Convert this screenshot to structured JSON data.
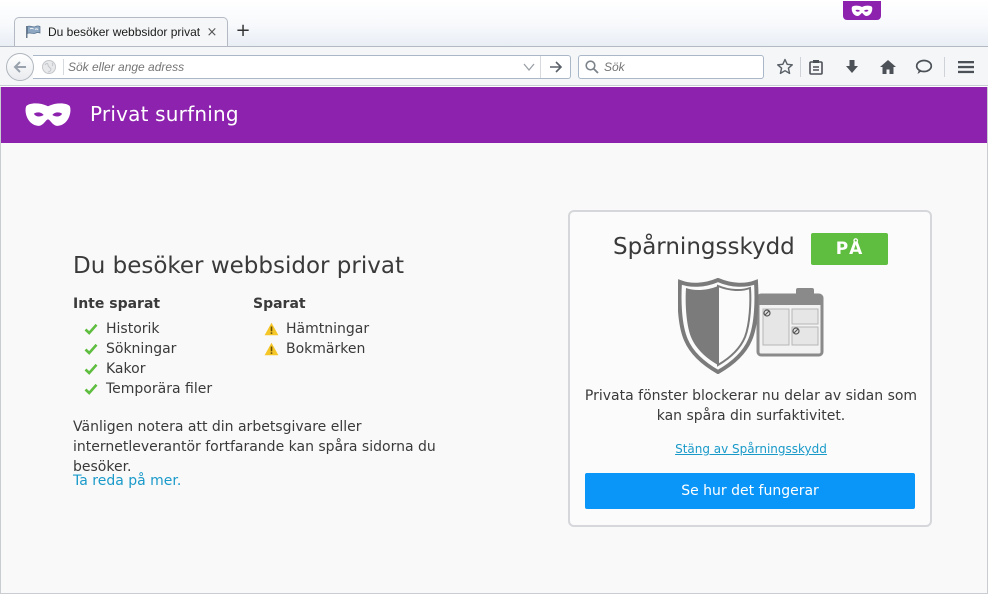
{
  "tab": {
    "title": "Du besöker webbsidor privat",
    "close_glyph": "×",
    "new_tab_glyph": "+",
    "favicon": "private-browsing-flag-icon"
  },
  "toolbar": {
    "url_placeholder": "Sök eller ange adress",
    "search_placeholder": "Sök",
    "icons": [
      "back-icon",
      "globe-icon",
      "dropdown-arrow-icon",
      "go-arrow-icon",
      "search-icon",
      "bookmark-star-icon",
      "reading-list-icon",
      "download-icon",
      "home-icon",
      "chat-icon",
      "hamburger-menu-icon"
    ]
  },
  "header": {
    "title": "Privat surfning",
    "bg_color": "#8c22ad"
  },
  "main": {
    "title": "Du besöker webbsidor privat",
    "not_saved": {
      "heading": "Inte sparat",
      "items": [
        "Historik",
        "Sökningar",
        "Kakor",
        "Temporära filer"
      ]
    },
    "saved": {
      "heading": "Sparat",
      "items": [
        "Hämtningar",
        "Bokmärken"
      ]
    },
    "notice": "Vänligen notera att din arbetsgivare eller internetleverantör fortfarande kan spåra sidorna du besöker.",
    "learn_more": "Ta reda på mer."
  },
  "tracking_protection": {
    "title": "Spårningsskydd",
    "status_badge": "PÅ",
    "description": "Privata fönster blockerar nu delar av sidan som kan spåra din surfaktivitet.",
    "disable_link": "Stäng av Spårningsskydd",
    "button": "Se hur det fungerar"
  },
  "colors": {
    "check_green": "#5fbd3f",
    "warning_yellow": "#f5c628",
    "link_blue": "#1a9ac9",
    "button_blue": "#0996f8"
  }
}
